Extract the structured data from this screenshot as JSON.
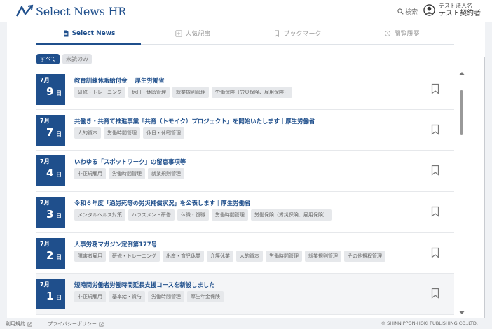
{
  "header": {
    "logo_text": "Select News HR",
    "search_label": "検索",
    "user_org": "テスト法人名",
    "user_name": "テスト契約者"
  },
  "tabs": [
    {
      "label": "Select News",
      "icon": "document-icon",
      "active": true
    },
    {
      "label": "人気記事",
      "icon": "plus-box-icon",
      "active": false
    },
    {
      "label": "ブックマーク",
      "icon": "bookmark-icon",
      "active": false
    },
    {
      "label": "閲覧履歴",
      "icon": "history-icon",
      "active": false
    }
  ],
  "filters": [
    {
      "label": "すべて",
      "active": true
    },
    {
      "label": "未読のみ",
      "active": false
    }
  ],
  "articles": [
    {
      "month": "7月",
      "day": "9",
      "day_suffix": "日",
      "title": "教育訓練休暇給付金 ｜厚生労働省",
      "tags": [
        "研修・トレーニング",
        "休日・休暇管理",
        "就業規則管理",
        "労働保険（労災保険、雇用保険）"
      ]
    },
    {
      "month": "7月",
      "day": "7",
      "day_suffix": "日",
      "title": "共働き・共育て推進事業「共育（トモイク）プロジェクト」を開始いたします｜厚生労働省",
      "tags": [
        "人的資本",
        "労働時間管理",
        "休日・休暇管理"
      ]
    },
    {
      "month": "7月",
      "day": "4",
      "day_suffix": "日",
      "title": "いわゆる「スポットワーク」の留意事項等",
      "tags": [
        "非正規雇用",
        "労働時間管理",
        "就業規則管理"
      ]
    },
    {
      "month": "7月",
      "day": "3",
      "day_suffix": "日",
      "title": "令和６年度「過労死等の労災補償状況」を公表します｜厚生労働省",
      "tags": [
        "メンタルヘルス対策",
        "ハラスメント研修",
        "休職・復職",
        "労働時間管理",
        "労働保険（労災保険、雇用保険）"
      ]
    },
    {
      "month": "7月",
      "day": "2",
      "day_suffix": "日",
      "title": "人事労務マガジン定例第177号",
      "tags": [
        "障害者雇用",
        "研修・トレーニング",
        "出産・育児休業",
        "介護休業",
        "人的資本",
        "労働時間管理",
        "就業規則管理",
        "その他規程管理"
      ]
    },
    {
      "month": "7月",
      "day": "1",
      "day_suffix": "日",
      "title": "短時間労働者労働時間延長支援コースを新設しました",
      "tags": [
        "非正規雇用",
        "基本給・賞与",
        "労働時間管理",
        "厚生年金保険"
      ]
    }
  ],
  "footer": {
    "terms": "利用規約",
    "privacy": "プライバシーポリシー",
    "copyright": "© SHINNIPPON-HOKI PUBLISHING CO.,LTD."
  },
  "colors": {
    "brand": "#1f4f8c",
    "tag_bg": "#e6e8eb"
  }
}
